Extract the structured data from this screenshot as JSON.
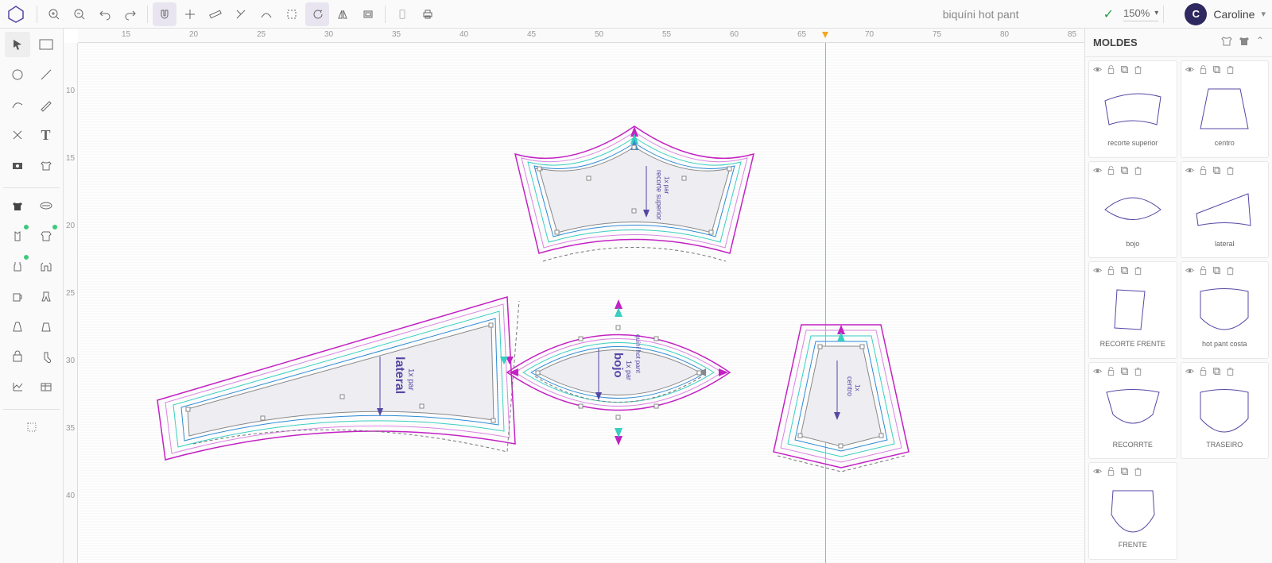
{
  "document_title": "biquíni hot pant",
  "zoom_level": "150%",
  "user": {
    "initial": "C",
    "name": "Caroline"
  },
  "ruler_h": [
    15,
    20,
    25,
    30,
    35,
    40,
    45,
    50,
    55,
    60,
    65,
    70,
    75,
    80,
    85
  ],
  "ruler_v": [
    10,
    15,
    20,
    25,
    30,
    35,
    40
  ],
  "panel_title": "MOLDES",
  "moldes": [
    {
      "label": "recorte superior"
    },
    {
      "label": "centro"
    },
    {
      "label": "bojo"
    },
    {
      "label": "lateral"
    },
    {
      "label": "RECORTE FRENTE"
    },
    {
      "label": "hot pant costa"
    },
    {
      "label": "RECORRTE"
    },
    {
      "label": "TRASEIRO"
    },
    {
      "label": "FRENTE"
    }
  ],
  "pieces": {
    "lateral": {
      "name": "lateral",
      "qty": "1x par"
    },
    "bojo": {
      "name": "bojo",
      "qty": "1x par",
      "note": "quíni hot pant"
    },
    "centro": {
      "name": "centro",
      "qty": "1x"
    },
    "recorte_superior": {
      "name": "recorte superior",
      "qty": "1x par"
    }
  }
}
